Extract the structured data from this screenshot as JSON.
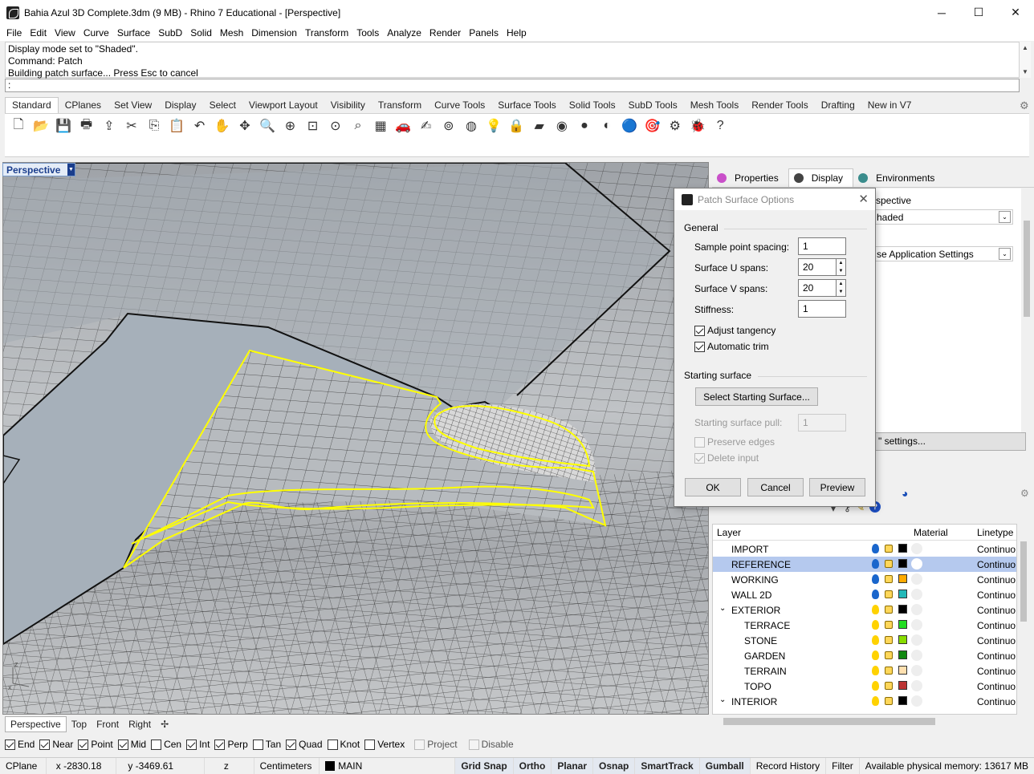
{
  "window": {
    "title": "Bahia Azul 3D Complete.3dm (9 MB) - Rhino 7 Educational - [Perspective]",
    "minimize": "─",
    "maximize": "☐",
    "close": "✕"
  },
  "menu": [
    "File",
    "Edit",
    "View",
    "Curve",
    "Surface",
    "SubD",
    "Solid",
    "Mesh",
    "Dimension",
    "Transform",
    "Tools",
    "Analyze",
    "Render",
    "Panels",
    "Help"
  ],
  "command": {
    "history": [
      "Display mode set to \"Shaded\".",
      "Command: Patch",
      "Building patch surface... Press Esc to cancel"
    ],
    "prompt": ":"
  },
  "toolbar_tabs": [
    "Standard",
    "CPlanes",
    "Set View",
    "Display",
    "Select",
    "Viewport Layout",
    "Visibility",
    "Transform",
    "Curve Tools",
    "Surface Tools",
    "Solid Tools",
    "SubD Tools",
    "Mesh Tools",
    "Render Tools",
    "Drafting",
    "New in V7"
  ],
  "toolbar_icons": [
    "new-icon",
    "open-icon",
    "save-icon",
    "print-icon",
    "import-icon",
    "cut-icon",
    "copy-icon",
    "paste-icon",
    "undo-icon",
    "pan-icon",
    "rotate-view-icon",
    "zoom-dynamic-icon",
    "zoom-window-icon",
    "zoom-extents-icon",
    "zoom-selected-icon",
    "zoom-all-icon",
    "four-view-icon",
    "car-icon",
    "object-properties-icon",
    "cplane-icon",
    "select-icon",
    "light-icon",
    "lock-icon",
    "layer-icon",
    "color-wheel-icon",
    "shaded-sphere-icon",
    "rendered-sphere-icon",
    "render-icon",
    "material-icon",
    "options-icon",
    "bug-icon",
    "help-icon"
  ],
  "toolbar_glyphs": [
    "🗋",
    "📂",
    "💾",
    "🖶",
    "⇪",
    "✂",
    "⎘",
    "📋",
    "↶",
    "✋",
    "✥",
    "🔍",
    "⊕",
    "⊡",
    "⊙",
    "⌕",
    "▦",
    "🚗",
    "✍",
    "⊚",
    "◍",
    "💡",
    "🔒",
    "▰",
    "◉",
    "●",
    "◐",
    "🔵",
    "🎯",
    "⚙",
    "🐞",
    "?"
  ],
  "viewport": {
    "name": "Perspective",
    "menu_arrow": "▼",
    "axis": {
      "z": "z",
      "x": "x"
    }
  },
  "view_tabs": [
    "Perspective",
    "Top",
    "Front",
    "Right"
  ],
  "view_tabs_add": "✢",
  "osnaps": [
    {
      "label": "End",
      "on": true
    },
    {
      "label": "Near",
      "on": true
    },
    {
      "label": "Point",
      "on": true
    },
    {
      "label": "Mid",
      "on": true
    },
    {
      "label": "Cen",
      "on": false
    },
    {
      "label": "Int",
      "on": true
    },
    {
      "label": "Perp",
      "on": true
    },
    {
      "label": "Tan",
      "on": false
    },
    {
      "label": "Quad",
      "on": true
    },
    {
      "label": "Knot",
      "on": false
    },
    {
      "label": "Vertex",
      "on": false
    },
    {
      "label": "Project",
      "on": false,
      "dim": true
    },
    {
      "label": "Disable",
      "on": false,
      "dim": true
    }
  ],
  "status": {
    "cplane": "CPlane",
    "x": "x -2830.18",
    "y": "y -3469.61",
    "z": "z",
    "units": "Centimeters",
    "layer": "MAIN",
    "toggles": [
      "Grid Snap",
      "Ortho",
      "Planar",
      "Osnap",
      "SmartTrack",
      "Gumball"
    ],
    "record": "Record History",
    "filter": "Filter",
    "memory": "Available physical memory: 13617 MB"
  },
  "right_panel": {
    "tabs": [
      {
        "label": "Properties",
        "icon": "properties-icon",
        "color": "#c94fc9"
      },
      {
        "label": "Display",
        "icon": "display-icon",
        "color": "#444444"
      },
      {
        "label": "Environments",
        "icon": "environments-icon",
        "color": "#3a8c8c"
      }
    ],
    "viewport_name": "rspective",
    "display_mode": "haded",
    "app_settings": "se Application Settings",
    "settings_button": "\" settings...",
    "layers_columns": {
      "layer": "Layer",
      "material": "Material",
      "linetype": "Linetype"
    },
    "layers": [
      {
        "name": "IMPORT",
        "indent": 0,
        "color": "#000000",
        "bulb": "#1a66cc",
        "linetype": "Continuo",
        "selected": false
      },
      {
        "name": "REFERENCE",
        "indent": 0,
        "color": "#000000",
        "bulb": "#1a66cc",
        "linetype": "Continuo",
        "selected": true
      },
      {
        "name": "WORKING",
        "indent": 0,
        "color": "#ffaa00",
        "bulb": "#1a66cc",
        "linetype": "Continuo",
        "selected": false
      },
      {
        "name": "WALL 2D",
        "indent": 0,
        "color": "#22b8b8",
        "bulb": "#1a66cc",
        "linetype": "Continuo",
        "selected": false
      },
      {
        "name": "EXTERIOR",
        "indent": 0,
        "color": "#000000",
        "bulb": "#ffd200",
        "linetype": "Continuo",
        "selected": false,
        "expanded": true
      },
      {
        "name": "TERRACE",
        "indent": 1,
        "color": "#22dd22",
        "bulb": "#ffd200",
        "linetype": "Continuo",
        "selected": false
      },
      {
        "name": "STONE",
        "indent": 1,
        "color": "#88dd00",
        "bulb": "#ffd200",
        "linetype": "Continuo",
        "selected": false
      },
      {
        "name": "GARDEN",
        "indent": 1,
        "color": "#118811",
        "bulb": "#ffd200",
        "linetype": "Continuo",
        "selected": false
      },
      {
        "name": "TERRAIN",
        "indent": 1,
        "color": "#ffe0b0",
        "bulb": "#ffd200",
        "linetype": "Continuo",
        "selected": false
      },
      {
        "name": "TOPO",
        "indent": 1,
        "color": "#bb3333",
        "bulb": "#ffd200",
        "linetype": "Continuo",
        "selected": false
      },
      {
        "name": "INTERIOR",
        "indent": 0,
        "color": "#000000",
        "bulb": "#ffd200",
        "linetype": "Continuo",
        "selected": false,
        "expanded": true
      }
    ],
    "chevron": "⌄"
  },
  "dialog": {
    "title": "Patch Surface Options",
    "close": "✕",
    "general": "General",
    "sample_point_spacing_label": "Sample point spacing:",
    "sample_point_spacing": "1",
    "u_spans_label": "Surface U spans:",
    "u_spans": "20",
    "v_spans_label": "Surface V spans:",
    "v_spans": "20",
    "stiffness_label": "Stiffness:",
    "stiffness": "1",
    "adjust_tangency": "Adjust tangency",
    "automatic_trim": "Automatic trim",
    "starting_surface": "Starting surface",
    "select_starting_surface": "Select Starting Surface...",
    "starting_surface_pull_label": "Starting surface pull:",
    "starting_surface_pull": "1",
    "preserve_edges": "Preserve edges",
    "delete_input": "Delete input",
    "ok": "OK",
    "cancel": "Cancel",
    "preview": "Preview"
  },
  "colors": {
    "accent": "#1a3d8c",
    "selection": "#b5c9ee",
    "curve_highlight": "#ffff00"
  }
}
